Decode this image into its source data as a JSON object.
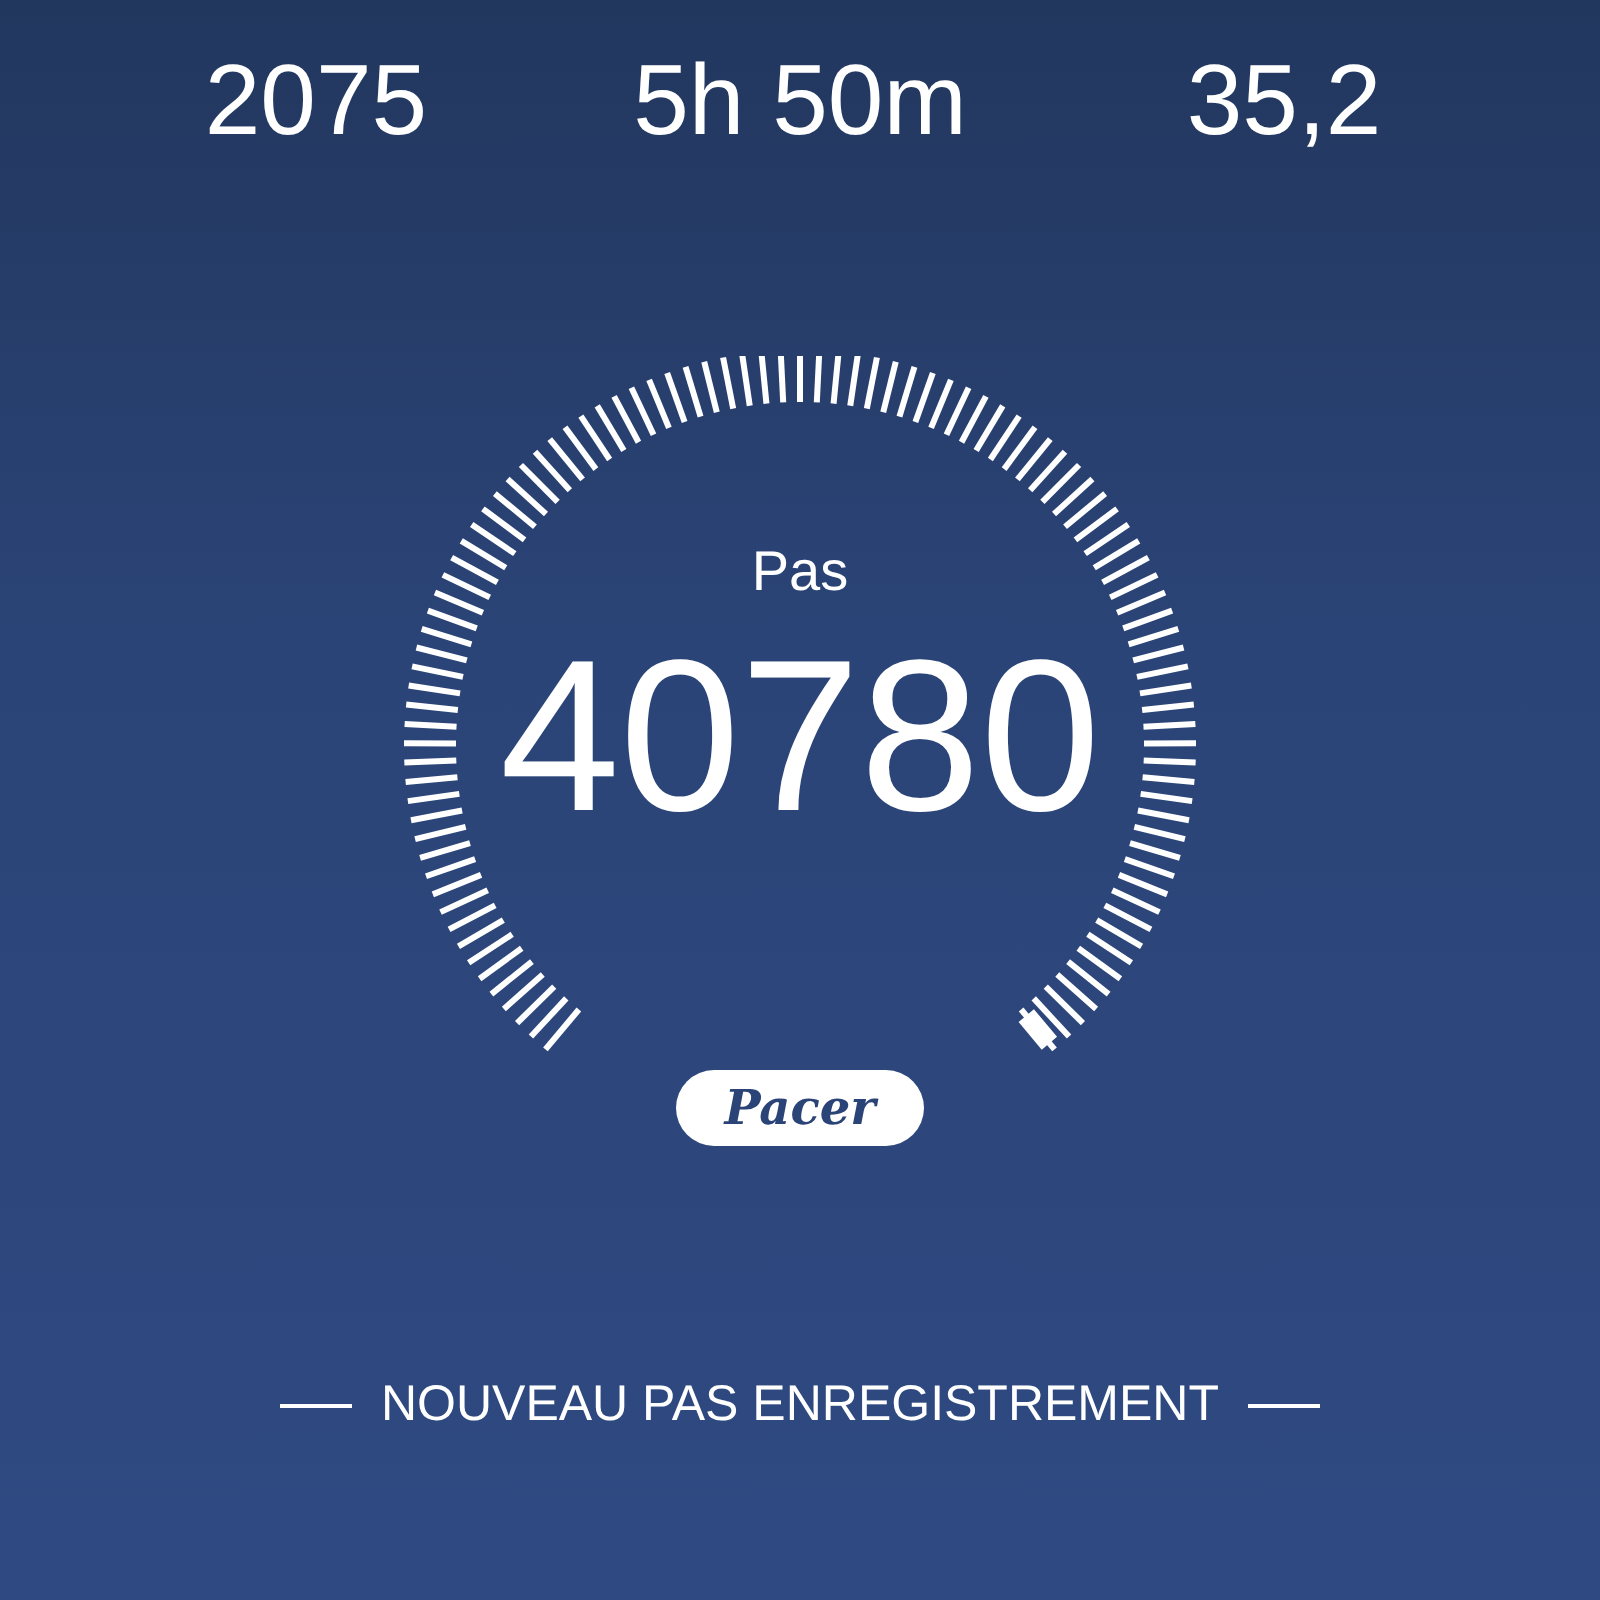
{
  "stats": [
    {
      "value": "2075"
    },
    {
      "value": "5h 50m"
    },
    {
      "value": "35,2"
    }
  ],
  "gauge": {
    "label": "Pas",
    "value": "40780"
  },
  "badge": {
    "text": "Pacer"
  },
  "banner": {
    "text": "NOUVEAU PAS ENREGISTREMENT"
  }
}
